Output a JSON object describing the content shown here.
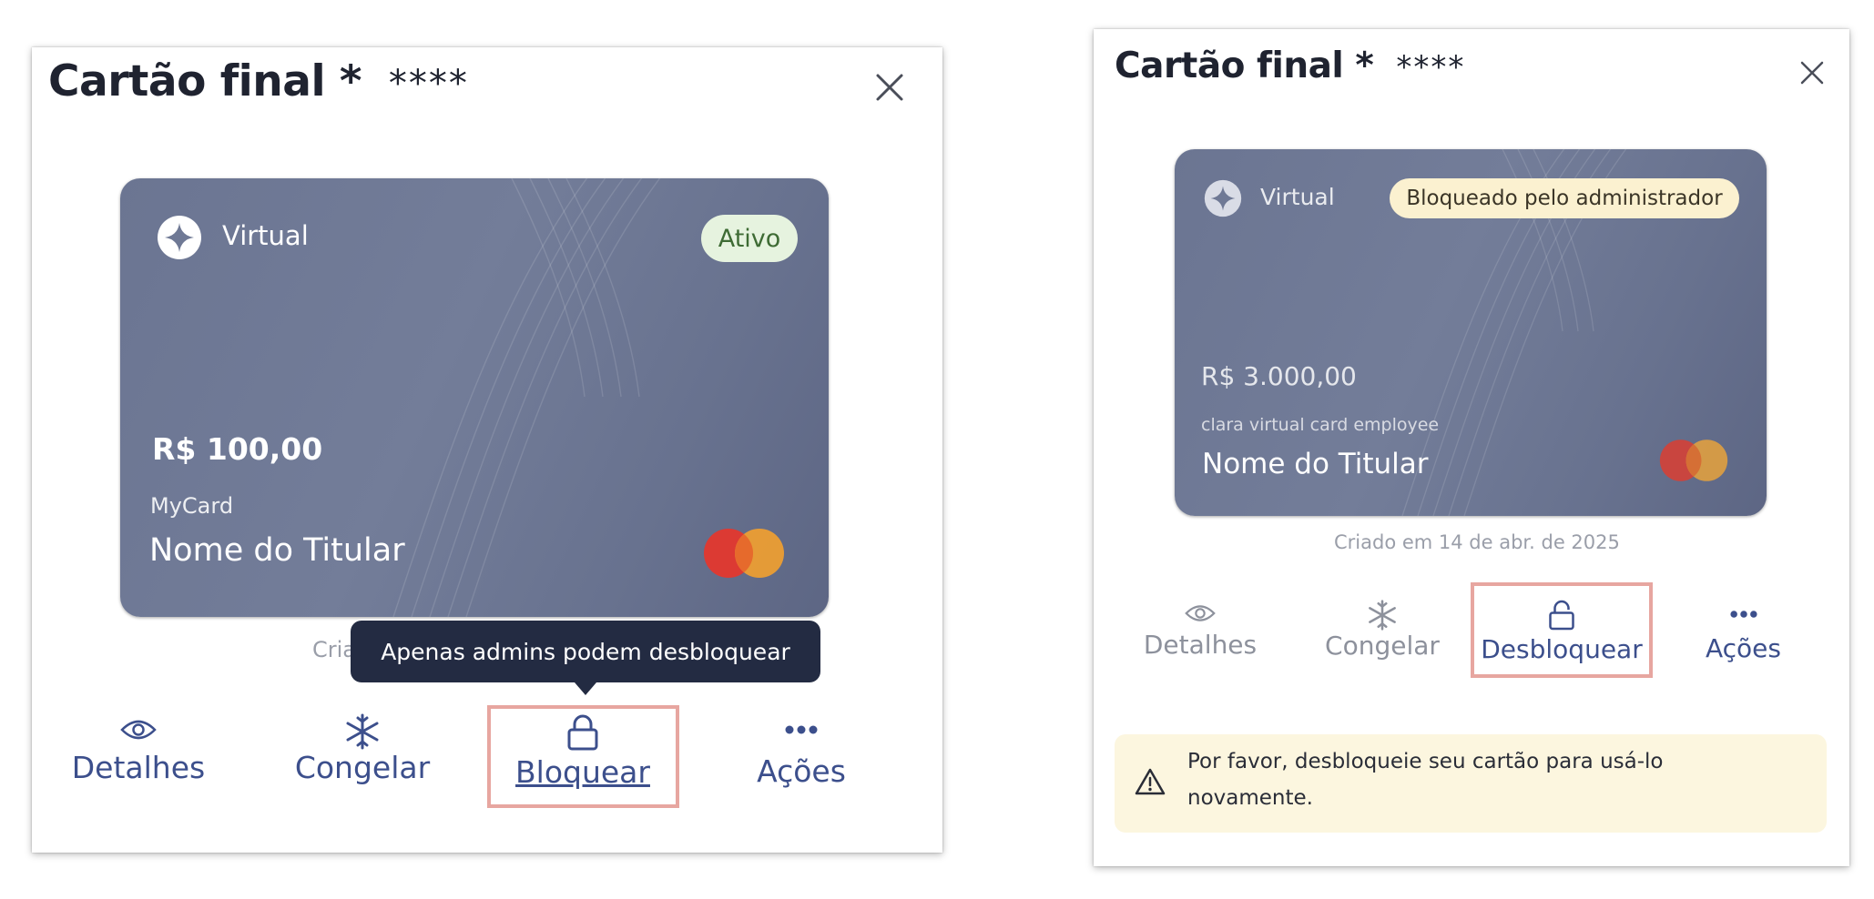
{
  "left": {
    "title": "Cartão final *",
    "title_mask": "****",
    "card": {
      "type": "Virtual",
      "status": "Ativo",
      "amount": "R$ 100,00",
      "name": "MyCard",
      "holder": "Nome do Titular"
    },
    "created_text": "Cria",
    "tooltip": "Apenas admins podem desbloquear",
    "actions": {
      "details": "Detalhes",
      "freeze": "Congelar",
      "lock": "Bloquear",
      "more": "Ações"
    }
  },
  "right": {
    "title": "Cartão final *",
    "title_mask": "****",
    "card": {
      "type": "Virtual",
      "status": "Bloqueado pelo administrador",
      "amount": "R$ 3.000,00",
      "name": "clara virtual card employee",
      "holder": "Nome do Titular"
    },
    "created_text": "Criado em 14 de abr. de 2025",
    "actions": {
      "details": "Detalhes",
      "freeze": "Congelar",
      "unlock": "Desbloquear",
      "more": "Ações"
    },
    "warning_text": "Por favor, desbloqueie seu cartão para usá-lo novamente."
  },
  "colors": {
    "action_blue": "#3c4f8c",
    "action_gray": "#8d919c",
    "active_badge_bg": "#e6f3df",
    "active_badge_text": "#3e6b34",
    "blocked_badge_bg": "#fbf1d0",
    "highlight": "#e7a6a0",
    "tooltip_bg": "#232b42",
    "warning_bg": "#fcf6df"
  },
  "icons": {
    "close": "close-icon",
    "brand": "sparkle-icon",
    "network": "mastercard-logo",
    "details": "eye-icon",
    "freeze": "snowflake-icon",
    "lock": "lock-icon",
    "unlock": "unlock-icon",
    "more": "more-dots-icon",
    "warning": "warning-icon"
  }
}
